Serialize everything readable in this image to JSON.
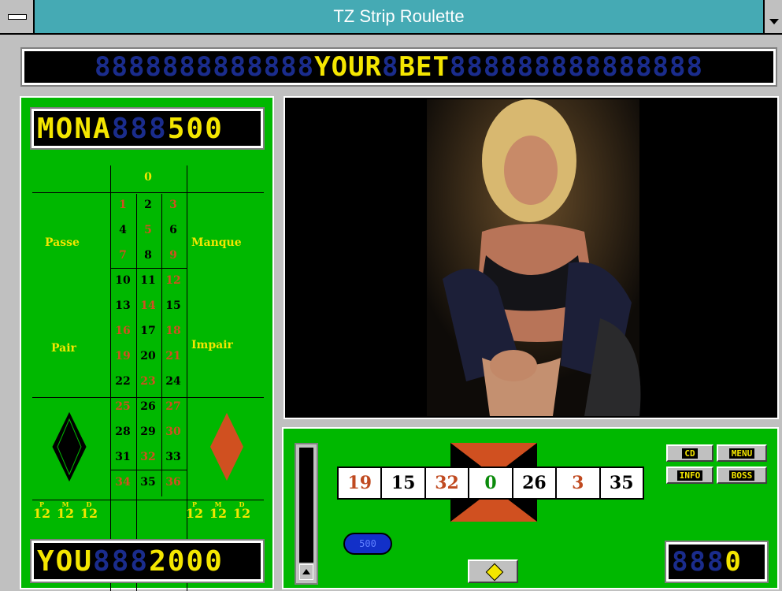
{
  "window": {
    "title": "TZ Strip Roulette"
  },
  "status_bar": {
    "dim_left": "8888888888888",
    "text_1": "YOUR",
    "dim_mid": "8",
    "text_2": "BET",
    "dim_right": "888888888888888"
  },
  "opponent": {
    "name": "MONA",
    "dim": "888",
    "amount": "500"
  },
  "player": {
    "name": "YOU",
    "dim": "888",
    "amount": "2000"
  },
  "table": {
    "zero": "0",
    "passe": "Passe",
    "manque": "Manque",
    "pair": "Pair",
    "impair": "Impair",
    "numbers": [
      {
        "n": "1",
        "c": "red"
      },
      {
        "n": "2",
        "c": "black"
      },
      {
        "n": "3",
        "c": "red"
      },
      {
        "n": "4",
        "c": "black"
      },
      {
        "n": "5",
        "c": "red"
      },
      {
        "n": "6",
        "c": "black"
      },
      {
        "n": "7",
        "c": "red"
      },
      {
        "n": "8",
        "c": "black"
      },
      {
        "n": "9",
        "c": "red"
      },
      {
        "n": "10",
        "c": "black"
      },
      {
        "n": "11",
        "c": "black"
      },
      {
        "n": "12",
        "c": "red"
      },
      {
        "n": "13",
        "c": "black"
      },
      {
        "n": "14",
        "c": "red"
      },
      {
        "n": "15",
        "c": "black"
      },
      {
        "n": "16",
        "c": "red"
      },
      {
        "n": "17",
        "c": "black"
      },
      {
        "n": "18",
        "c": "red"
      },
      {
        "n": "19",
        "c": "red"
      },
      {
        "n": "20",
        "c": "black"
      },
      {
        "n": "21",
        "c": "red"
      },
      {
        "n": "22",
        "c": "black"
      },
      {
        "n": "23",
        "c": "red"
      },
      {
        "n": "24",
        "c": "black"
      },
      {
        "n": "25",
        "c": "red"
      },
      {
        "n": "26",
        "c": "black"
      },
      {
        "n": "27",
        "c": "red"
      },
      {
        "n": "28",
        "c": "black"
      },
      {
        "n": "29",
        "c": "black"
      },
      {
        "n": "30",
        "c": "red"
      },
      {
        "n": "31",
        "c": "black"
      },
      {
        "n": "32",
        "c": "red"
      },
      {
        "n": "33",
        "c": "black"
      },
      {
        "n": "34",
        "c": "red"
      },
      {
        "n": "35",
        "c": "black"
      },
      {
        "n": "36",
        "c": "red"
      }
    ],
    "dozens_left": [
      {
        "sup": "P",
        "big": "12"
      },
      {
        "sup": "M",
        "big": "12"
      },
      {
        "sup": "D",
        "big": "12"
      }
    ],
    "dozens_right": [
      {
        "sup": "P",
        "big": "12"
      },
      {
        "sup": "M",
        "big": "12"
      },
      {
        "sup": "D",
        "big": "12"
      }
    ]
  },
  "wheel": {
    "numbers": [
      {
        "n": "19",
        "c": "red"
      },
      {
        "n": "15",
        "c": "black"
      },
      {
        "n": "32",
        "c": "red"
      },
      {
        "n": "0",
        "c": "green"
      },
      {
        "n": "26",
        "c": "black"
      },
      {
        "n": "3",
        "c": "red"
      },
      {
        "n": "35",
        "c": "black"
      }
    ]
  },
  "chip": {
    "label": "500"
  },
  "buttons": {
    "b1": "CD",
    "b2": "MENU",
    "b3": "INFO",
    "b4": "BOSS"
  },
  "credit": {
    "dim": "888",
    "value": "0"
  },
  "colors": {
    "felt": "#00b800",
    "lcd_text": "#f4e600",
    "red": "#d05020",
    "title": "#45aab4"
  }
}
